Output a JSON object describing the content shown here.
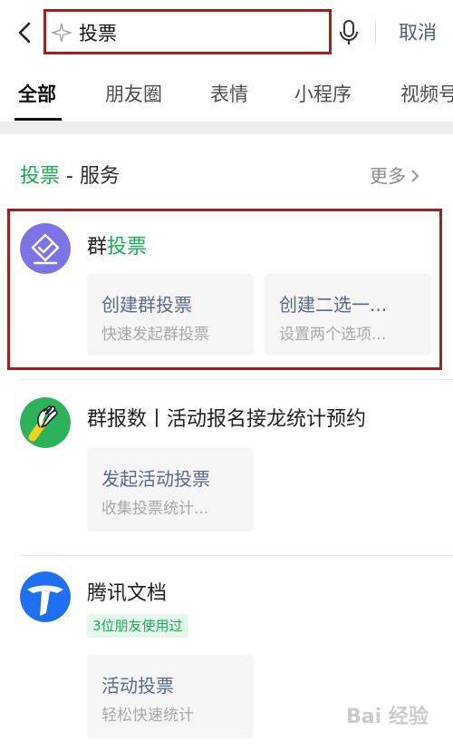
{
  "search": {
    "query": "投票",
    "cancel_label": "取消"
  },
  "tabs": [
    {
      "label": "全部",
      "active": true
    },
    {
      "label": "朋友圈",
      "active": false
    },
    {
      "label": "表情",
      "active": false
    },
    {
      "label": "小程序",
      "active": false
    },
    {
      "label": "视频号",
      "active": false
    }
  ],
  "section": {
    "title_highlight": "投票",
    "title_rest": " - 服务",
    "more_label": "更多"
  },
  "results": [
    {
      "name_prefix": "群",
      "name_highlight": "投票",
      "icon": "vote-check-icon",
      "chips": [
        {
          "title": "创建群投票",
          "subtitle": "快速发起群投票"
        },
        {
          "title": "创建二选一...",
          "subtitle": "设置两个选项..."
        }
      ]
    },
    {
      "name": "群报数丨活动报名接龙统计预约",
      "icon": "waving-hand-icon",
      "chips": [
        {
          "title": "发起活动投票",
          "subtitle": "收集投票统计..."
        }
      ]
    },
    {
      "name": "腾讯文档",
      "icon": "tencent-docs-icon",
      "badge": "3位朋友使用过",
      "chips": [
        {
          "title": "活动投票",
          "subtitle": "轻松快速统计"
        }
      ]
    }
  ],
  "watermark": "Bai 经验",
  "colors": {
    "highlight_green": "#1aad54",
    "annotation_red": "#a3201f",
    "link_blue": "#596a8a",
    "vote_icon_purple": "#7b73e6",
    "docs_icon_blue": "#1e6ff2"
  }
}
